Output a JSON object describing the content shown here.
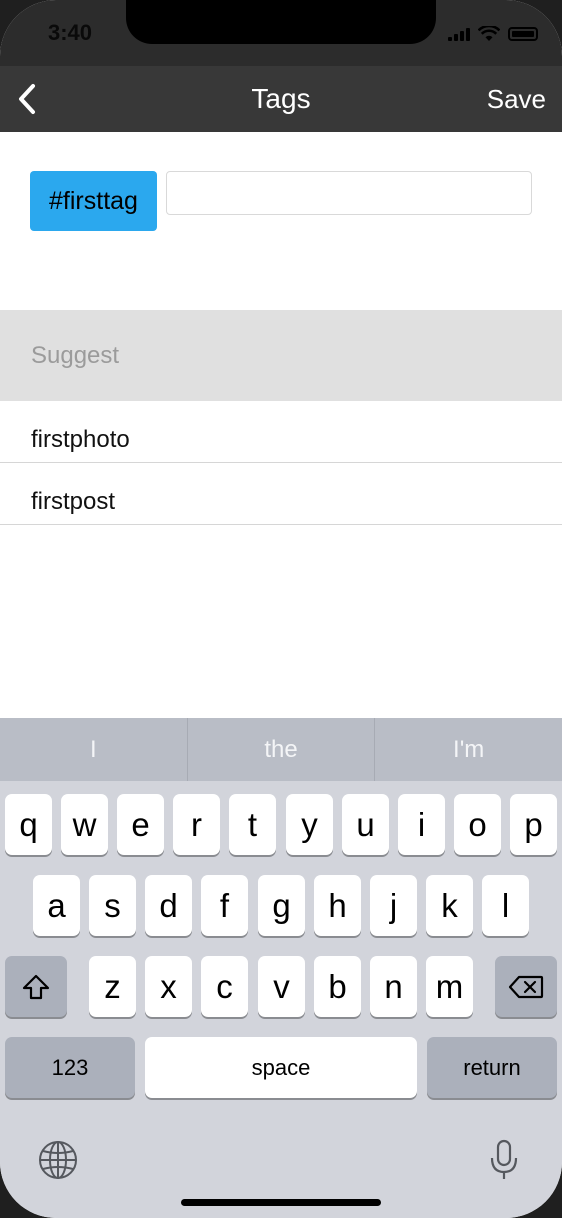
{
  "status": {
    "time": "3:40"
  },
  "nav": {
    "title": "Tags",
    "save_label": "Save"
  },
  "tags": {
    "chips": [
      "#firsttag"
    ],
    "input_value": "",
    "input_placeholder": ""
  },
  "suggest": {
    "header": "Suggest",
    "items": [
      "firstphoto",
      "firstpost"
    ]
  },
  "keyboard": {
    "predictions": [
      "I",
      "the",
      "I'm"
    ],
    "row1": [
      "q",
      "w",
      "e",
      "r",
      "t",
      "y",
      "u",
      "i",
      "o",
      "p"
    ],
    "row2": [
      "a",
      "s",
      "d",
      "f",
      "g",
      "h",
      "j",
      "k",
      "l"
    ],
    "row3": [
      "z",
      "x",
      "c",
      "v",
      "b",
      "n",
      "m"
    ],
    "numbers_label": "123",
    "space_label": "space",
    "return_label": "return"
  },
  "colors": {
    "nav_bg": "#383838",
    "tag_chip": "#2ba8ee",
    "suggest_bg": "#e0e0e0",
    "keyboard_bg": "#d2d4db"
  }
}
